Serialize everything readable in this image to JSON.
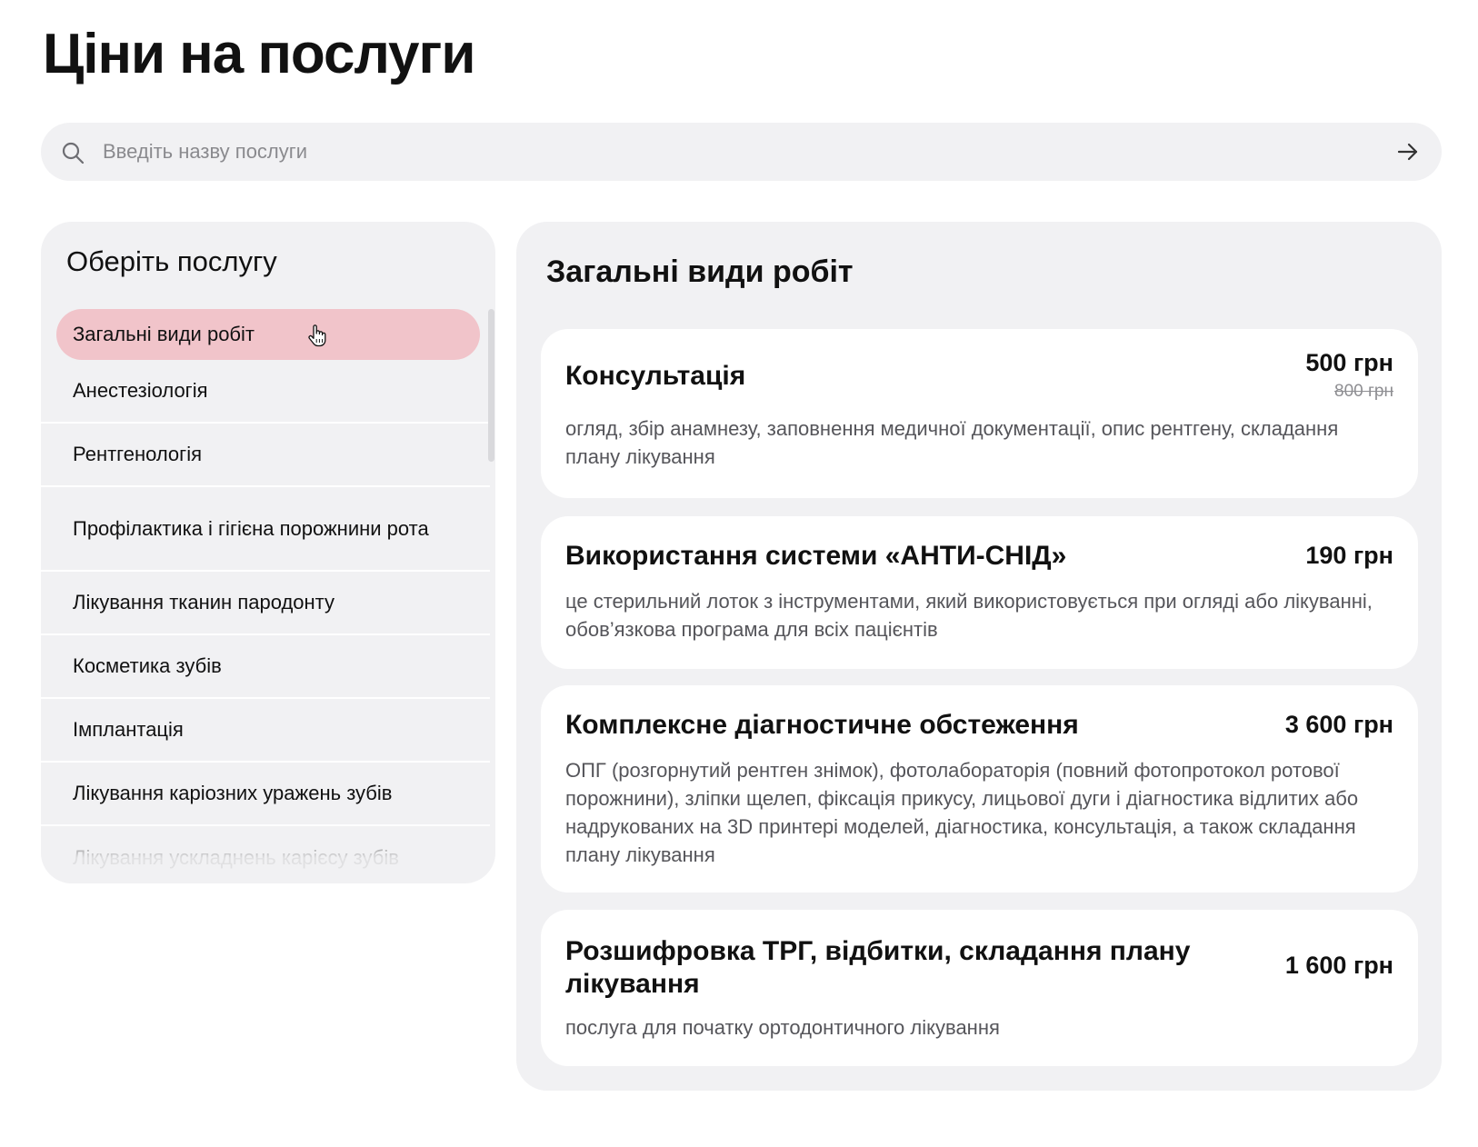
{
  "page": {
    "title": "Ціни на послуги"
  },
  "search": {
    "placeholder": "Введіть назву послуги"
  },
  "sidebar": {
    "title": "Оберіть послугу",
    "items": [
      {
        "label": "Загальні види робіт",
        "active": true
      },
      {
        "label": "Анестезіологія"
      },
      {
        "label": "Рентгенологія"
      },
      {
        "label": "Профілактика і гігієна порожнини рота"
      },
      {
        "label": "Лікування тканин пародонту"
      },
      {
        "label": "Косметика зубів"
      },
      {
        "label": "Імплантація"
      },
      {
        "label": "Лікування каріозних уражень зубів"
      },
      {
        "label": "Лікування ускладнень карієсу зубів"
      }
    ]
  },
  "main": {
    "title": "Загальні види робіт",
    "services": [
      {
        "name": "Консультація",
        "price": "500 грн",
        "old_price": "800 грн",
        "description": "огляд, збір анамнезу, заповнення медичної документації, опис рентгену, складання плану лікування"
      },
      {
        "name": "Використання системи «АНТИ-СНІД»",
        "price": "190 грн",
        "description": "це стерильний лоток з інструментами, який використовується при огляді або лікуванні, обов’язкова програма для всіх пацієнтів"
      },
      {
        "name": "Комплексне діагностичне обстеження",
        "price": "3 600 грн",
        "description": "ОПГ (розгорнутий рентген знімок), фотолабораторія (повний фотопротокол ротової порожнини), зліпки щелеп, фіксація прикусу, лицьової дуги і діагностика відлитих або надрукованих на 3D принтері моделей, діагностика, консультація, а також складання плану лікування"
      },
      {
        "name": "Розшифровка ТРГ, відбитки, складання плану лікування",
        "price": "1 600 грн",
        "description": "послуга для початку ортодонтичного лікування"
      }
    ]
  },
  "colors": {
    "active_item_bg": "#f1c4ca",
    "panel_bg": "#f1f1f3",
    "card_bg": "#ffffff"
  }
}
